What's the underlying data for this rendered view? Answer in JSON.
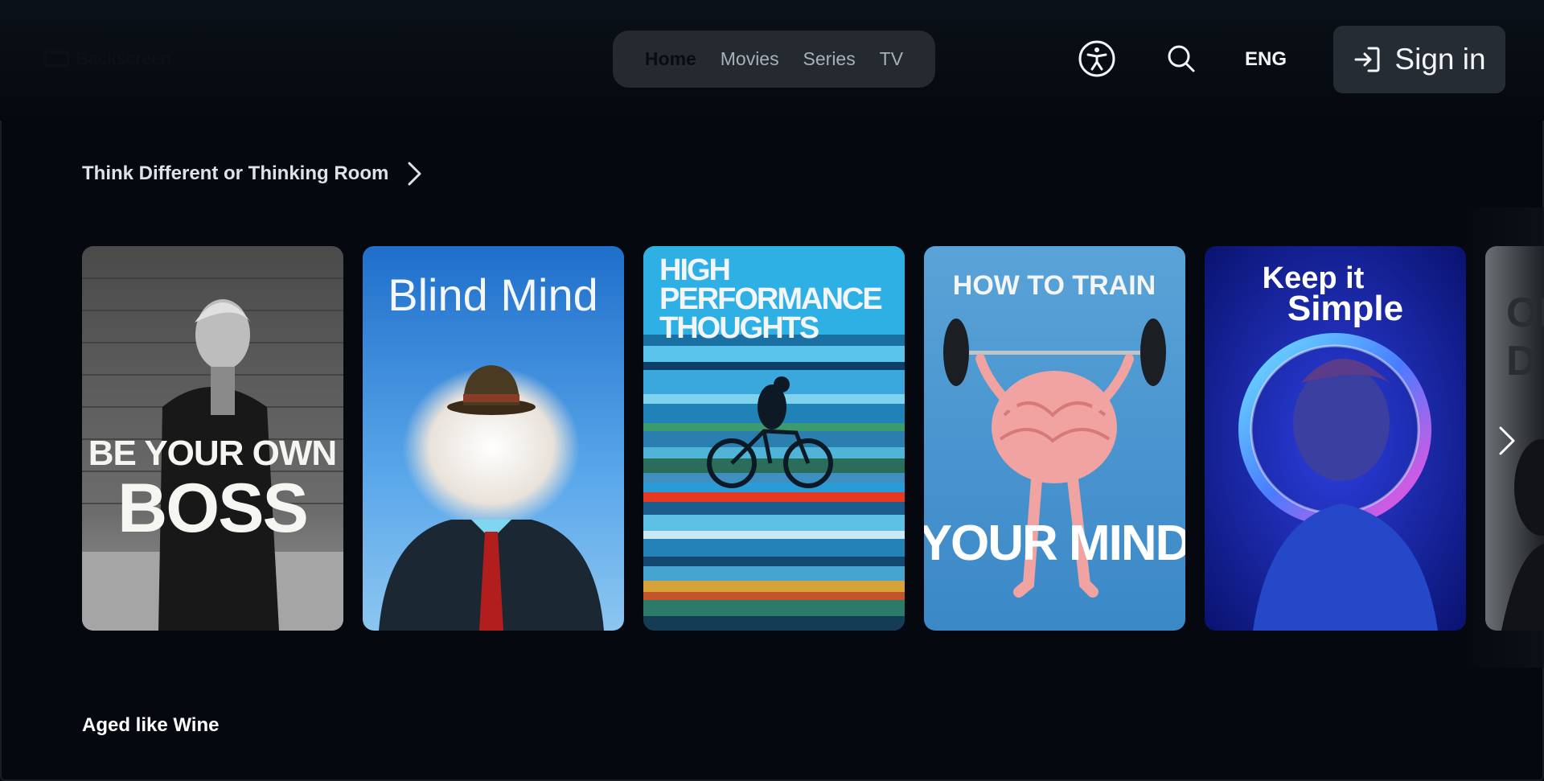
{
  "header": {
    "logo_text": "Backscreen",
    "nav": [
      {
        "label": "Home",
        "active": true
      },
      {
        "label": "Movies",
        "active": false
      },
      {
        "label": "Series",
        "active": false
      },
      {
        "label": "TV",
        "active": false
      }
    ],
    "accessibility_icon": "accessibility-icon",
    "search_icon": "search-icon",
    "language": "ENG",
    "signin_label": "Sign in",
    "signin_icon": "sign-in-icon"
  },
  "sections": [
    {
      "title": "Think Different or Thinking Room",
      "chevron_icon": "chevron-right-icon",
      "cards": [
        {
          "line1": "BE YOUR OWN",
          "line2": "BOSS"
        },
        {
          "title": "Blind Mind"
        },
        {
          "line1": "HIGH",
          "line2": "PERFORMANCE",
          "line3": "THOUGHTS"
        },
        {
          "line1": "HOW TO TRAIN",
          "line2": "YOUR MIND"
        },
        {
          "line1": "Keep it",
          "line2": "Simple"
        },
        {
          "line1": "OI",
          "line2": "D"
        }
      ],
      "next_icon": "chevron-right-icon"
    },
    {
      "title": "Aged like Wine"
    }
  ],
  "colors": {
    "background": "#05090f",
    "nav_pill": "#252a31",
    "signin_bg": "#262c33"
  }
}
